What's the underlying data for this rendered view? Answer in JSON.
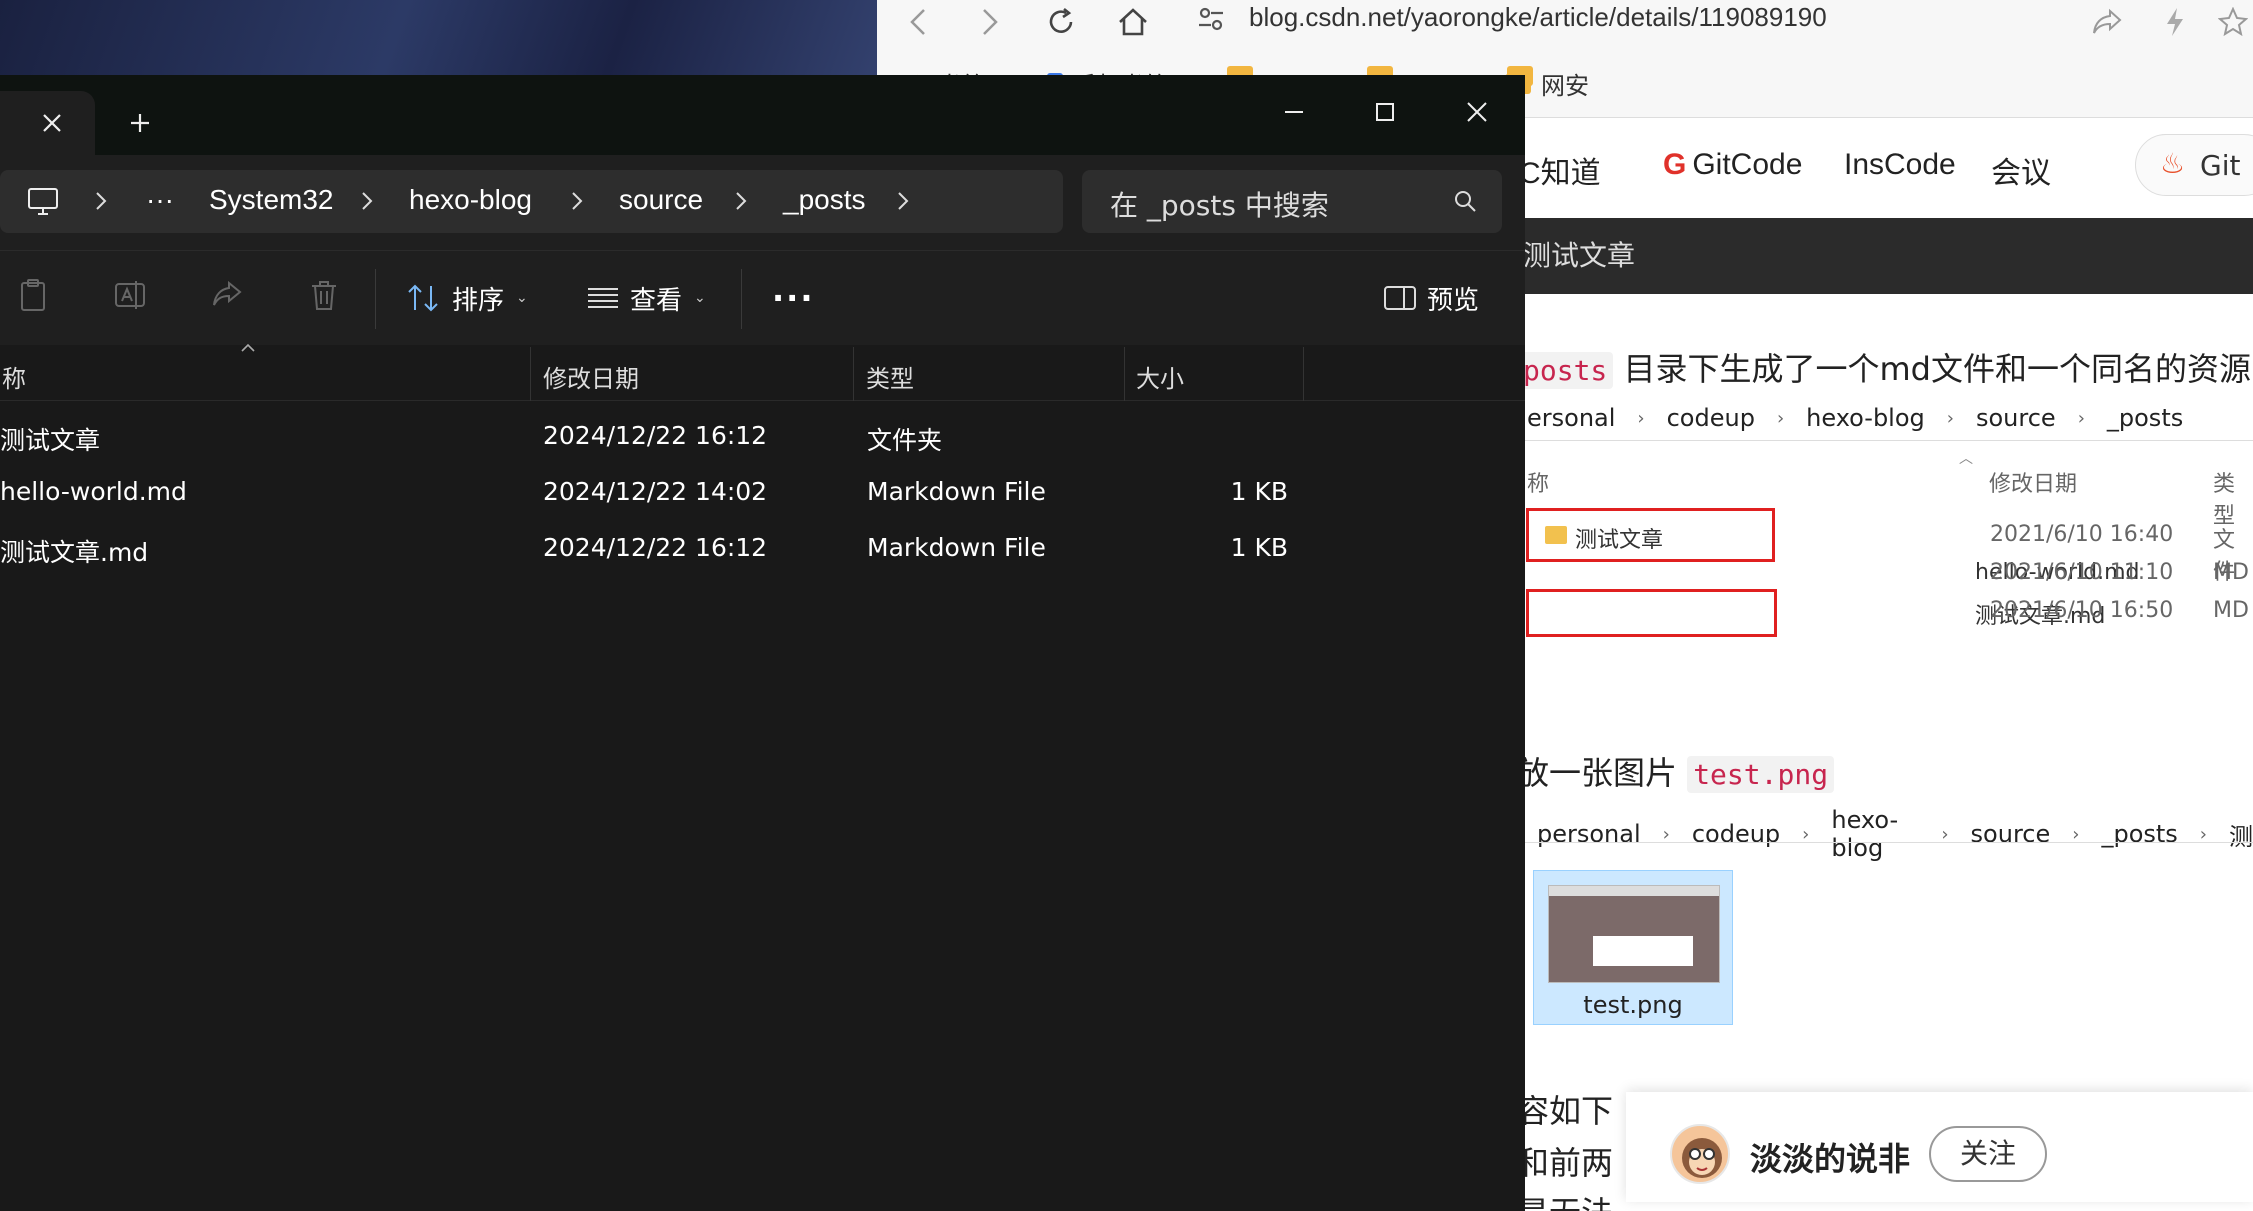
{
  "browser": {
    "url": "blog.csdn.net/yaorongke/article/details/119089190",
    "bookmarks": [
      "书签",
      "手机书签",
      "",
      "",
      "网安"
    ],
    "nav": [
      "C知道",
      "GitCode",
      "InsCode",
      "会议"
    ],
    "nav_pill": "Git",
    "bar_title": "测试文章",
    "para1_code": "posts",
    "para1_text": "目录下生成了一个md文件和一个同名的资源目录",
    "shot1_crumb": [
      "ersonal",
      "codeup",
      "hexo-blog",
      "source",
      "_posts"
    ],
    "shot1_headers": [
      "称",
      "修改日期",
      "类型"
    ],
    "shot1_rows": [
      {
        "name": "测试文章",
        "date": "2021/6/10 16:40",
        "type": "文件"
      },
      {
        "name": "hello-world.md",
        "date": "2021/6/10 11:10",
        "type": "MD"
      },
      {
        "name": "测试文章.md",
        "date": "2021/6/10 16:50",
        "type": "MD"
      }
    ],
    "para2_text": "放一张图片",
    "para2_code": "test.png",
    "shot2_crumb": [
      "personal",
      "codeup",
      "hexo-blog",
      "source",
      "_posts",
      "测"
    ],
    "thumb_label": "test.png",
    "para3_a": "容如下",
    "para3_b": "和前两",
    "para3_c": "是无法",
    "author": "淡淡的说非",
    "follow": "关注"
  },
  "explorer": {
    "breadcrumb": [
      "System32",
      "hexo-blog",
      "source",
      "_posts"
    ],
    "ellipsis": "···",
    "search_placeholder": "在 _posts 中搜索",
    "sort_label": "排序",
    "view_label": "查看",
    "more_label": "···",
    "preview_label": "预览",
    "columns": [
      "称",
      "修改日期",
      "类型",
      "大小"
    ],
    "files": [
      {
        "name": "测试文章",
        "date": "2024/12/22 16:12",
        "type": "文件夹",
        "size": ""
      },
      {
        "name": "hello-world.md",
        "date": "2024/12/22 14:02",
        "type": "Markdown File",
        "size": "1 KB"
      },
      {
        "name": "测试文章.md",
        "date": "2024/12/22 16:12",
        "type": "Markdown File",
        "size": "1 KB"
      }
    ]
  }
}
